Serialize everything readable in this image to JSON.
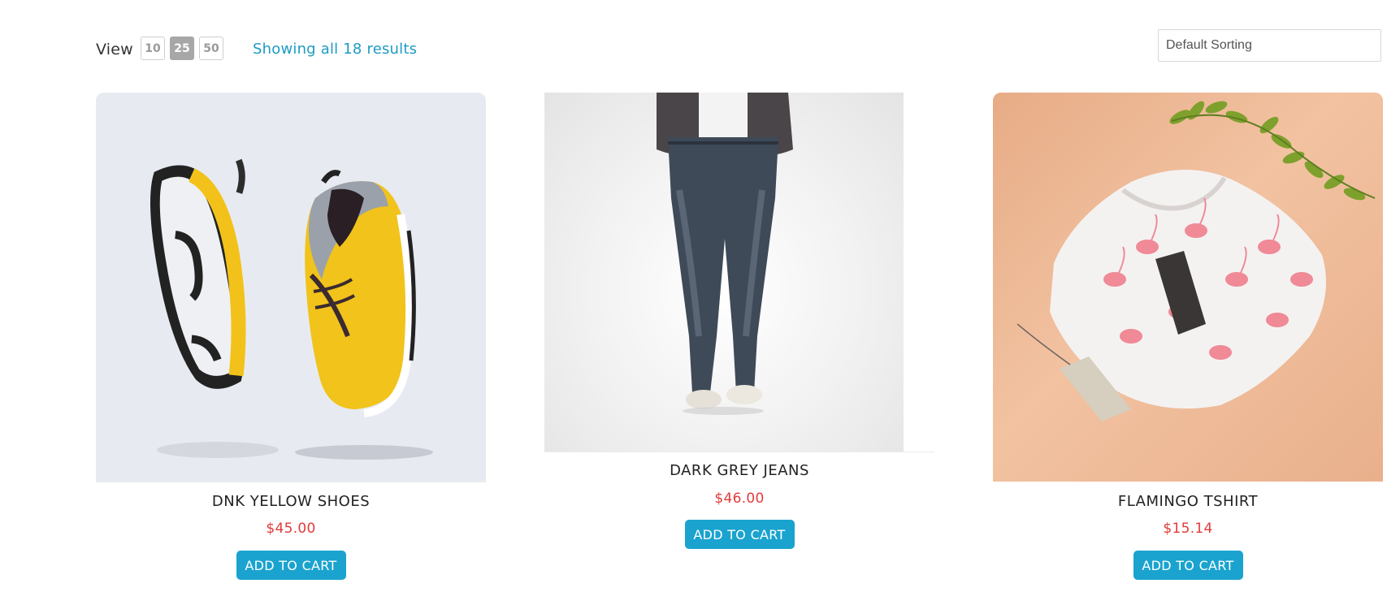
{
  "toolbar": {
    "view_label": "View",
    "view_options": [
      "10",
      "25",
      "50"
    ],
    "active_view": "25",
    "results_text": "Showing all 18 results",
    "sort_selected": "Default Sorting"
  },
  "products": [
    {
      "name": "DNK YELLOW SHOES",
      "price": "$45.00",
      "button": "ADD TO CART",
      "image": "yellow-sneakers-photo"
    },
    {
      "name": "DARK GREY JEANS",
      "price": "$46.00",
      "button": "ADD TO CART",
      "image": "dark-grey-jeans-photo"
    },
    {
      "name": "FLAMINGO TSHIRT",
      "price": "$15.14",
      "button": "ADD TO CART",
      "image": "flamingo-tshirt-photo"
    }
  ],
  "colors": {
    "accent": "#1aa3cf",
    "price": "#e23b3b",
    "results_link": "#1d9bc3",
    "active_view_bg": "#a7a7a7"
  }
}
